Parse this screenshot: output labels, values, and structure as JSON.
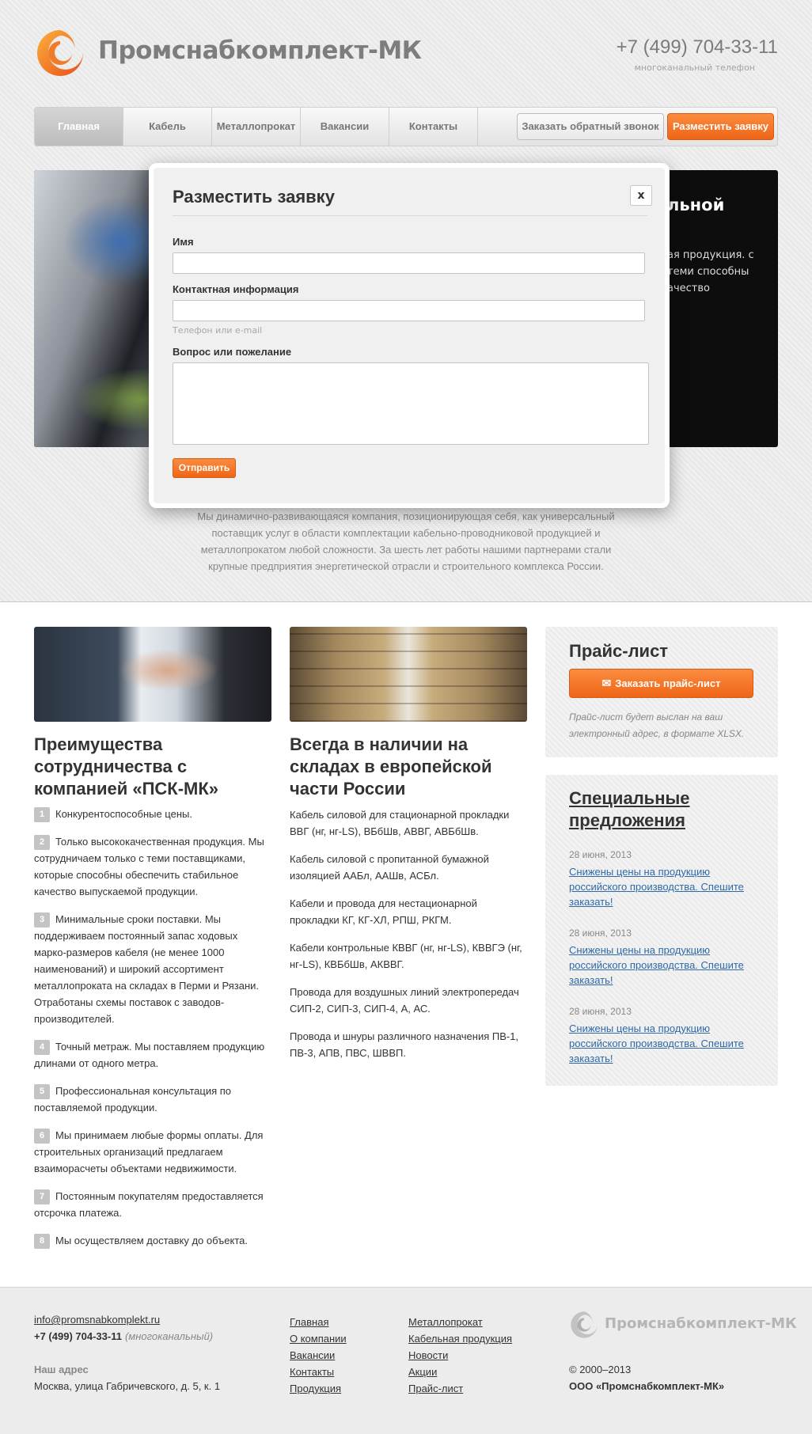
{
  "header": {
    "logo_text": "Промснабкомплект-МК",
    "phone": "+7 (499) 704-33-11",
    "phone_note": "многоканальный телефон"
  },
  "nav": {
    "items": [
      {
        "label": "Главная",
        "active": true
      },
      {
        "label": "Кабель"
      },
      {
        "label": "Металлопрокат"
      },
      {
        "label": "Вакансии"
      },
      {
        "label": "Контакты"
      }
    ],
    "callback_label": "Заказать обратный звонок",
    "request_label": "Разместить заявку"
  },
  "slider": {
    "title_visible": "льной",
    "text_visible": "ая продукция. с теми способны ачество"
  },
  "intro_text": "Мы динамично-развивающаяся компания, позиционирующая себя, как универсальный поставщик услуг в области комплектации кабельно-проводниковой продукцией и металлопрокатом любой сложности. За шесть лет работы нашими партнерами стали крупные предприятия энергетической отрасли и строительного комплекса России.",
  "modal": {
    "title": "Разместить заявку",
    "close_label": "x",
    "name_label": "Имя",
    "name_value": "",
    "contact_label": "Контактная информация",
    "contact_value": "",
    "contact_hint": "Телефон или e-mail",
    "question_label": "Вопрос или пожелание",
    "question_value": "",
    "submit_label": "Отправить"
  },
  "advantages": {
    "heading": "Преимущества сотрудничества с компанией «ПСК-МК»",
    "items": [
      {
        "num": "1",
        "text": "Конкурентоспособные цены."
      },
      {
        "num": "2",
        "text": "Только высококачественная продукция. Мы сотрудничаем только с теми поставщиками, которые способны обеспечить стабильное качество выпускаемой продукции."
      },
      {
        "num": "3",
        "text": "Минимальные сроки поставки. Мы поддерживаем постоянный запас ходовых марко-размеров кабеля (не менее 1000 наименований) и широкий ассортимент металлопроката на складах в Перми и Рязани. Отработаны схемы поставок с заводов-производителей."
      },
      {
        "num": "4",
        "text": "Точный метраж. Мы поставляем продукцию длинами от одного метра."
      },
      {
        "num": "5",
        "text": "Профессиональная консультация по поставляемой продукции."
      },
      {
        "num": "6",
        "text": "Мы принимаем любые формы оплаты. Для строительных организаций предлагаем взаиморасчеты объектами недвижимости."
      },
      {
        "num": "7",
        "text": "Постоянным покупателям предоставляется отсрочка платежа."
      },
      {
        "num": "8",
        "text": "Мы осуществляем доставку до объекта."
      }
    ]
  },
  "stock": {
    "heading": "Всегда в наличии на складах в европейской части России",
    "items": [
      "Кабель силовой для стационарной прокладки ВВГ (нг, нг-LS), ВБбШв, АВВГ, АВБбШв.",
      "Кабель силовой с пропитанной бумажной изоляцией ААБл, ААШв, АСБл.",
      "Кабели и провода для нестационарной прокладки КГ, КГ-ХЛ, РПШ, РКГМ.",
      "Кабели контрольные КВВГ (нг, нг-LS), КВВГЭ (нг, нг-LS), КВБбШв, АКВВГ.",
      "Провода для воздушных линий электропередач СИП-2, СИП-3, СИП-4, А, АС.",
      "Провода и шнуры различного назначения ПВ-1, ПВ-3, АПВ, ПВС, ШВВП."
    ]
  },
  "price": {
    "title": "Прайс-лист",
    "button_label": "Заказать прайс-лист",
    "note": "Прайс-лист будет выслан на ваш электронный адрес, в формате XLSX."
  },
  "specials": {
    "title": "Специальные предложения",
    "items": [
      {
        "date": "28 июня, 2013",
        "text": "Снижены цены на продукцию российского производства. Спешите заказать!"
      },
      {
        "date": "28 июня, 2013",
        "text": "Снижены цены на продукцию российского производства. Спешите заказать!"
      },
      {
        "date": "28 июня, 2013",
        "text": "Снижены цены на продукцию российского производства. Спешите заказать!"
      }
    ]
  },
  "footer": {
    "email": "info@promsnabkomplekt.ru",
    "phone": "+7 (499) 704-33-11",
    "phone_note": "(многоканальный)",
    "address_label": "Наш адрес",
    "address": "Москва, улица Габричевского, д. 5, к. 1",
    "links_col1": [
      "Главная",
      "О компании",
      "Вакансии",
      "Контакты",
      "Продукция"
    ],
    "links_col2": [
      "Металлопрокат",
      "Кабельная продукция",
      "Новости",
      "Акции",
      "Прайс-лист"
    ],
    "logo_text": "Промснабкомплект-МК",
    "copyright": "© 2000–2013",
    "company": "ООО «Промснабкомплект-МК»"
  },
  "colors": {
    "accent": "#f57421",
    "link": "#2f6aa8"
  }
}
